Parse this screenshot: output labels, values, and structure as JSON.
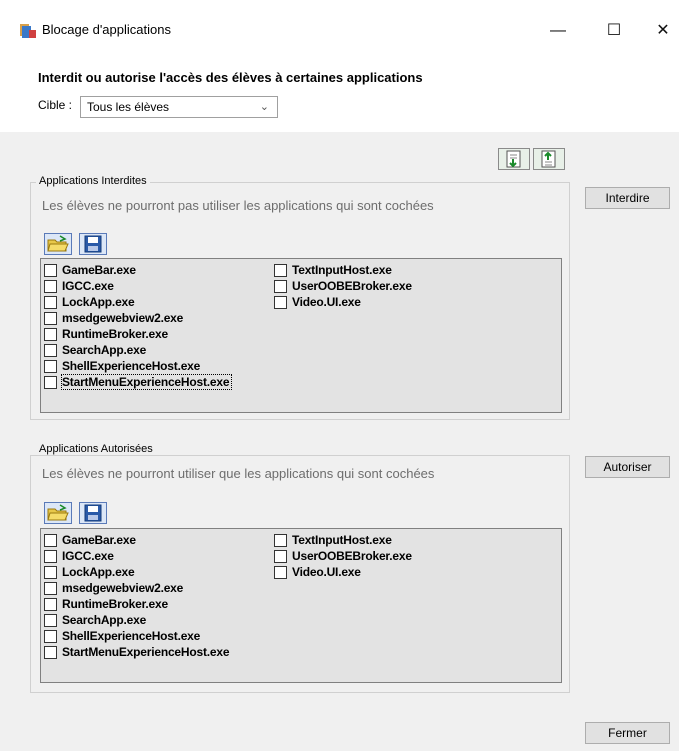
{
  "window": {
    "title": "Blocage d'applications",
    "minimize_glyph": "—",
    "maximize_glyph": "☐",
    "close_glyph": "✕"
  },
  "header": {
    "heading": "Interdit ou autorise l'accès des élèves à certaines applications",
    "cible_label": "Cible :",
    "cible_value": "Tous les élèves"
  },
  "forbidden": {
    "legend": "Applications Interdites",
    "description": "Les élèves ne pourront pas utiliser les applications qui sont cochées",
    "button": "Interdire",
    "col1": [
      "GameBar.exe",
      "IGCC.exe",
      "LockApp.exe",
      "msedgewebview2.exe",
      "RuntimeBroker.exe",
      "SearchApp.exe",
      "ShellExperienceHost.exe",
      "StartMenuExperienceHost.exe"
    ],
    "col2": [
      "TextInputHost.exe",
      "UserOOBEBroker.exe",
      "Video.UI.exe"
    ]
  },
  "allowed": {
    "legend": "Applications Autorisées",
    "description": "Les élèves ne pourront utiliser que les applications qui sont cochées",
    "button": "Autoriser",
    "col1": [
      "GameBar.exe",
      "IGCC.exe",
      "LockApp.exe",
      "msedgewebview2.exe",
      "RuntimeBroker.exe",
      "SearchApp.exe",
      "ShellExperienceHost.exe",
      "StartMenuExperienceHost.exe"
    ],
    "col2": [
      "TextInputHost.exe",
      "UserOOBEBroker.exe",
      "Video.UI.exe"
    ]
  },
  "footer": {
    "close_button": "Fermer"
  },
  "icons": {
    "app": "app-icon",
    "import": "import-icon",
    "export": "export-icon",
    "open": "folder-open-icon",
    "save": "floppy-save-icon"
  },
  "colors": {
    "accent": "#1e5aa8",
    "checklist_bg": "#e3e3e3"
  }
}
